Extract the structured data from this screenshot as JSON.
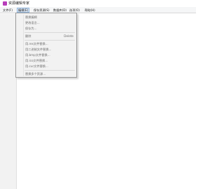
{
  "window": {
    "title": "资源编辑专家"
  },
  "menubar": {
    "items": [
      {
        "label": "文件(F)"
      },
      {
        "label": "编辑(E)"
      },
      {
        "label": "保存资源(S)"
      },
      {
        "label": "数据库(D)"
      },
      {
        "label": "选项(O)"
      },
      {
        "label": "帮助(H)"
      }
    ]
  },
  "edit_menu": {
    "items": [
      {
        "label": "替换编辑",
        "shortcut": ""
      },
      {
        "label": "更改语言...",
        "shortcut": ""
      },
      {
        "label": "保存为...",
        "shortcut": ""
      },
      {
        "label": "删除",
        "shortcut": "Delete"
      },
      {
        "label": "用.res文件替换...",
        "shortcut": ""
      },
      {
        "label": "用二进制文件替换...",
        "shortcut": ""
      },
      {
        "label": "用.bmp文件替换...",
        "shortcut": ""
      },
      {
        "label": "用.ico文件替换...",
        "shortcut": ""
      },
      {
        "label": "用.cur文件替换...",
        "shortcut": ""
      },
      {
        "label": "替换多个资源...",
        "shortcut": ""
      }
    ]
  },
  "colors": {
    "accent": "#b83dba",
    "menu_highlight": "#dce8f6",
    "disabled_text": "#6d6d6d"
  }
}
